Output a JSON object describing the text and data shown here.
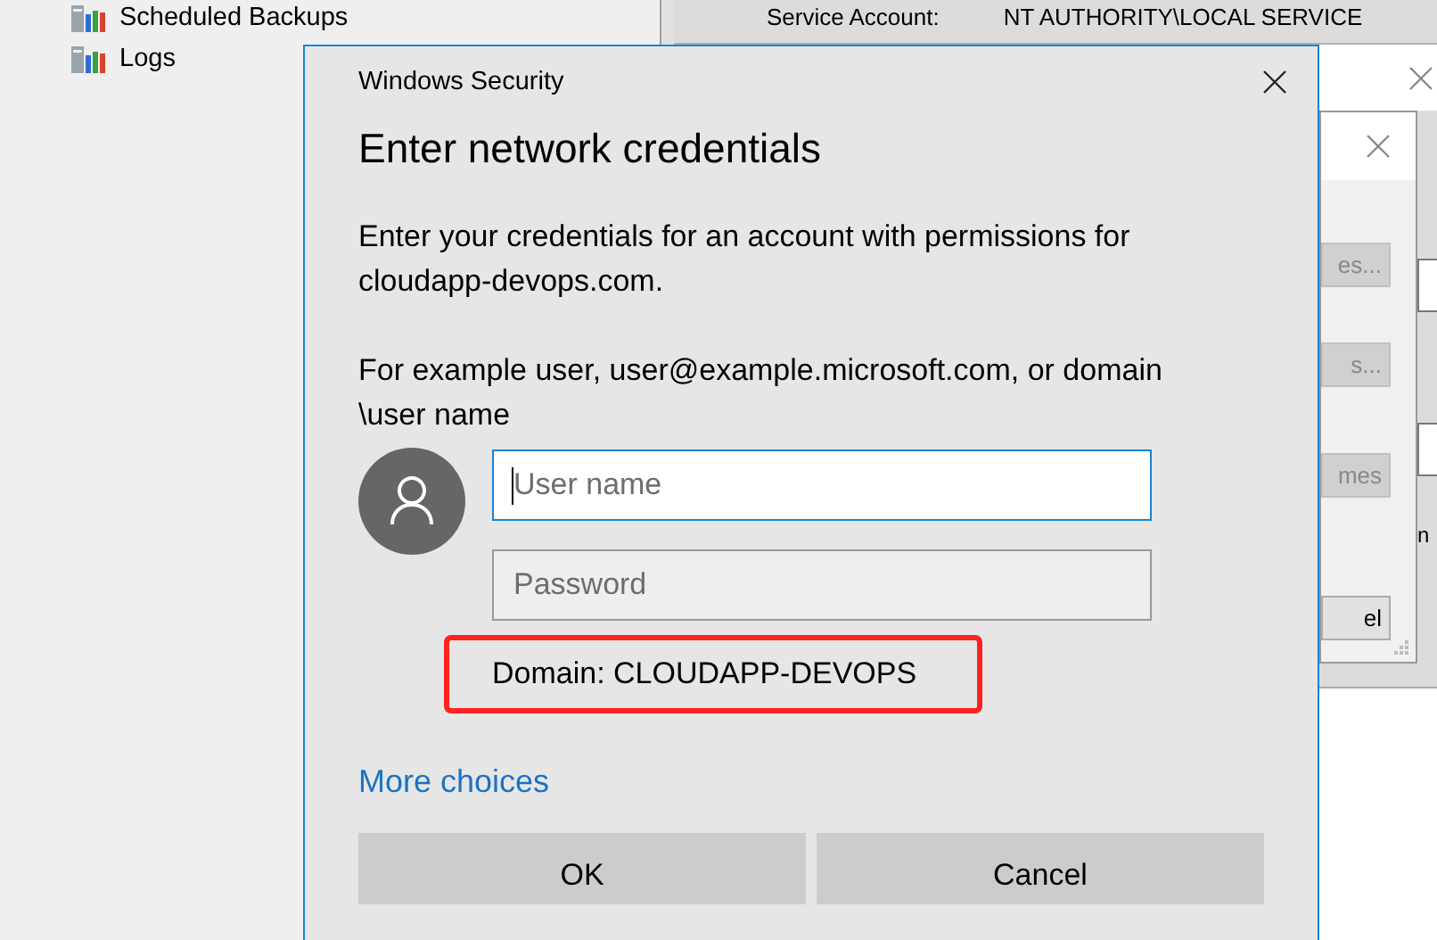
{
  "background": {
    "tree_items": [
      {
        "label": "Scheduled Backups"
      },
      {
        "label": "Logs"
      }
    ],
    "service_account": {
      "label": "Service Account:",
      "value": "NT AUTHORITY\\LOCAL SERVICE"
    },
    "behind_buttons": [
      {
        "label": "es...",
        "disabled": true
      },
      {
        "label": "s...",
        "disabled": true
      },
      {
        "label": "mes",
        "disabled": true
      },
      {
        "label": "el",
        "disabled": false
      }
    ],
    "edge_text": "n"
  },
  "dialog": {
    "title": "Windows Security",
    "heading": "Enter network credentials",
    "message": "Enter your credentials for an account with permissions for cloudapp-devops.com.",
    "example": "For example user, user@example.microsoft.com, or domain \\user name",
    "username": {
      "placeholder": "User name",
      "focused": true
    },
    "password": {
      "placeholder": "Password",
      "focused": false
    },
    "domain": "Domain: CLOUDAPP-DEVOPS",
    "more_choices": "More choices",
    "buttons": [
      "OK",
      "Cancel"
    ]
  }
}
